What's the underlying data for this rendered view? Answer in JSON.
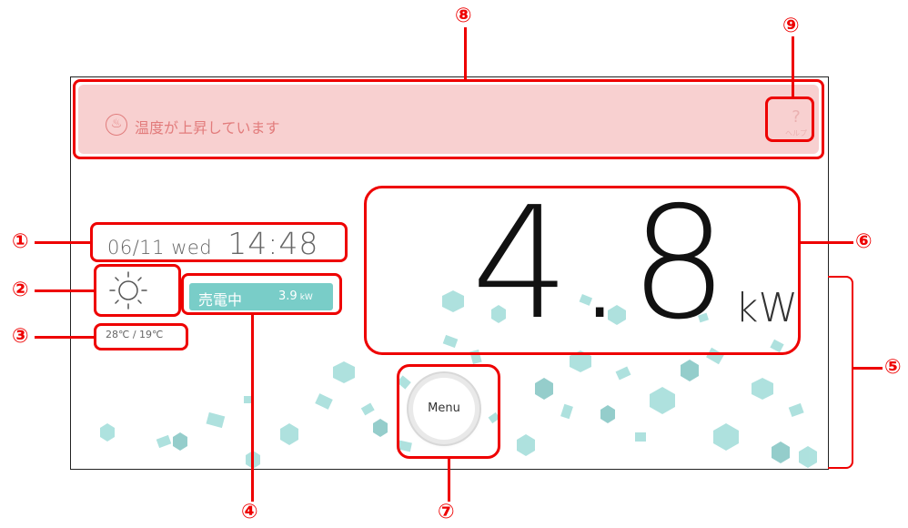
{
  "alert": {
    "text": "温度が上昇しています",
    "icon": "thermometer-hand-icon"
  },
  "help": {
    "symbol": "?",
    "label": "ヘルプ"
  },
  "datetime": {
    "date": "06/11 wed",
    "time": "14:48"
  },
  "weather": {
    "icon": "sun-icon",
    "temperatures": "28℃ / 19℃"
  },
  "selling": {
    "label": "売電中",
    "value": "3.9",
    "unit": "kW"
  },
  "power": {
    "value": "4.8",
    "unit": "kW"
  },
  "menu": {
    "label": "Menu"
  },
  "annotations": [
    "①",
    "②",
    "③",
    "④",
    "⑤",
    "⑥",
    "⑦",
    "⑧",
    "⑨"
  ],
  "colors": {
    "alert_bg": "#f8d0d0",
    "alert_text": "#e27c7c",
    "badge_bg": "#79cdc8",
    "annotation": "#ee0000"
  }
}
